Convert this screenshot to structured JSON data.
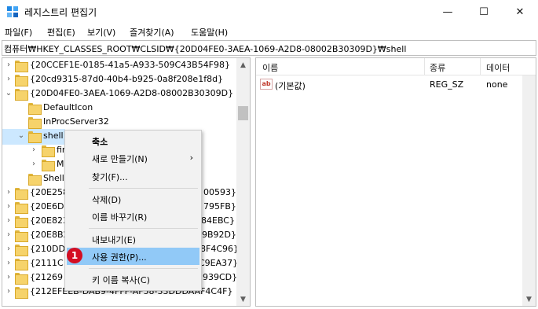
{
  "window": {
    "title": "레지스트리 편집기",
    "minimize_glyph": "—",
    "maximize_glyph": "☐",
    "close_glyph": "✕"
  },
  "menu": [
    "파일(F)",
    "편집(E)",
    "보기(V)",
    "즐겨찾기(A)",
    "도움말(H)"
  ],
  "address": "컴퓨터₩HKEY_CLASSES_ROOT₩CLSID₩{20D04FE0-3AEA-1069-A2D8-08002B30309D}₩shell",
  "tree": [
    {
      "label": "{20CCEF1E-0185-41a5-A933-509C43B54F98}",
      "state": "collapsed"
    },
    {
      "label": "{20cd9315-87d0-40b4-b925-0a8f208e1f8d}",
      "state": "collapsed"
    },
    {
      "label": "{20D04FE0-3AEA-1069-A2D8-08002B30309D}",
      "state": "expanded"
    },
    {
      "label": "DefaultIcon",
      "state": "leaf"
    },
    {
      "label": "InProcServer32",
      "state": "leaf"
    },
    {
      "label": "shell",
      "state": "expanded"
    },
    {
      "label": "fir",
      "state": "collapsed"
    },
    {
      "label": "M",
      "state": "collapsed"
    },
    {
      "label": "Shell",
      "state": "leaf"
    },
    {
      "label": "{20E258",
      "suffix": "00593}",
      "state": "collapsed"
    },
    {
      "label": "{20E6D",
      "suffix": "795FB}",
      "state": "collapsed"
    },
    {
      "label": "{20E823",
      "suffix": "84EBC}",
      "state": "collapsed"
    },
    {
      "label": "{20E8B2",
      "suffix": "9B92D}",
      "state": "collapsed"
    },
    {
      "label": "{210DD",
      "suffix": "8F4C96}",
      "state": "collapsed"
    },
    {
      "label": "{2111C",
      "suffix": "C9EA37}",
      "state": "collapsed"
    },
    {
      "label": "{21269",
      "suffix": "939CD}",
      "state": "collapsed"
    },
    {
      "label": "{212EFEEB-DAB9-4FFF-AF58-33DDDAAF4C4F}",
      "state": "collapsed"
    }
  ],
  "list": {
    "headers": [
      "이름",
      "종류",
      "데이터"
    ],
    "rows": [
      {
        "icon": "ab",
        "name": "(기본값)",
        "type": "REG_SZ",
        "data": "none"
      }
    ]
  },
  "context_menu": {
    "items": [
      {
        "label": "축소",
        "bold": true
      },
      {
        "label": "새로 만들기(N)",
        "submenu": true
      },
      {
        "label": "찾기(F)..."
      },
      {
        "separator": true
      },
      {
        "label": "삭제(D)"
      },
      {
        "label": "이름 바꾸기(R)"
      },
      {
        "separator": true
      },
      {
        "label": "내보내기(E)"
      },
      {
        "label": "사용 권한(P)...",
        "highlighted": true
      },
      {
        "separator": true
      },
      {
        "label": "키 이름 복사(C)"
      }
    ],
    "submenu_arrow": "›"
  },
  "step_badge": "1",
  "colors": {
    "highlight": "#91c9f7",
    "badge": "#d40e22",
    "folder": "#f6d36b"
  }
}
